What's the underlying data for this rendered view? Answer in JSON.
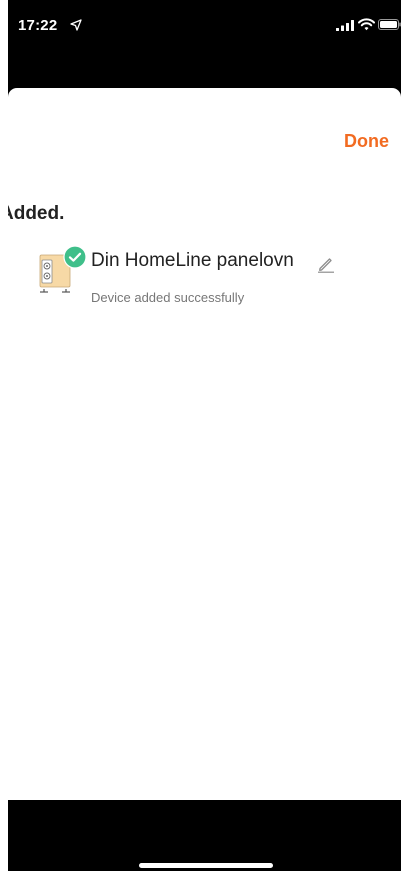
{
  "status_bar": {
    "time": "17:22",
    "icons": [
      "location-arrow-icon",
      "cellular-signal-icon",
      "wifi-icon",
      "battery-icon"
    ]
  },
  "header": {
    "done_label": "Done"
  },
  "main": {
    "section_title": "Added.",
    "devices": [
      {
        "name": "Din HomeLine panelovn",
        "status": "Device added successfully",
        "icon": "panel-heater-icon",
        "badge": "check-circle-icon"
      }
    ]
  },
  "colors": {
    "accent": "#f26b21",
    "success": "#3fbf8a",
    "text_primary": "#222222",
    "text_secondary": "#777777",
    "background": "#ffffff",
    "bars": "#000000"
  }
}
